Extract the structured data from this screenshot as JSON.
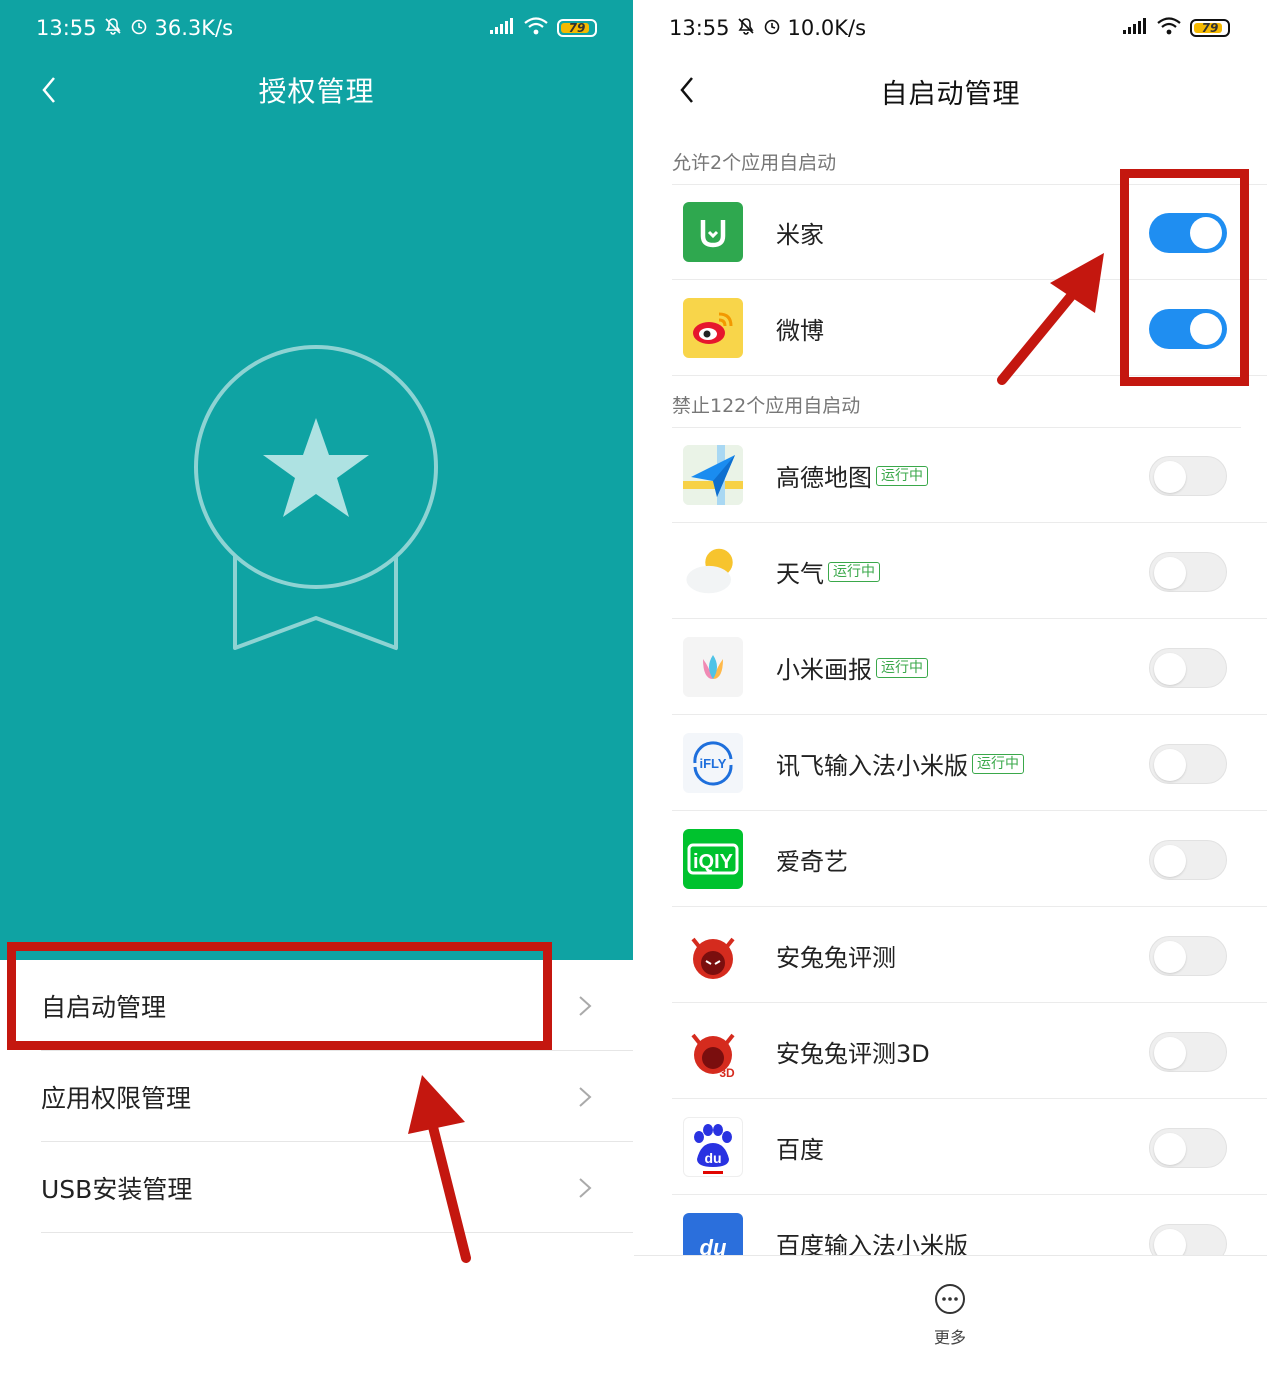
{
  "left": {
    "status": {
      "time": "13:55",
      "speed": "36.3K/s",
      "battery": "79"
    },
    "title": "授权管理",
    "menu": [
      {
        "label": "自启动管理"
      },
      {
        "label": "应用权限管理"
      },
      {
        "label": "USB安装管理"
      }
    ]
  },
  "right": {
    "status": {
      "time": "13:55",
      "speed": "10.0K/s",
      "battery": "79"
    },
    "title": "自启动管理",
    "allowed_header": "允许2个应用自启动",
    "blocked_header": "禁止122个应用自启动",
    "allowed_apps": [
      {
        "name": "米家",
        "enabled": true,
        "icon": "mijia-icon"
      },
      {
        "name": "微博",
        "enabled": true,
        "icon": "weibo-icon"
      }
    ],
    "blocked_apps": [
      {
        "name": "高德地图",
        "running": "运行中",
        "enabled": false,
        "icon": "amap-icon"
      },
      {
        "name": "天气",
        "running": "运行中",
        "enabled": false,
        "icon": "weather-icon"
      },
      {
        "name": "小米画报",
        "running": "运行中",
        "enabled": false,
        "icon": "mi-wallpaper-icon"
      },
      {
        "name": "讯飞输入法小米版",
        "running": "运行中",
        "enabled": false,
        "icon": "ifly-icon"
      },
      {
        "name": "爱奇艺",
        "enabled": false,
        "icon": "iqiyi-icon"
      },
      {
        "name": "安兔兔评测",
        "enabled": false,
        "icon": "antutu-icon"
      },
      {
        "name": "安兔兔评测3D",
        "enabled": false,
        "icon": "antutu-3d-icon"
      },
      {
        "name": "百度",
        "enabled": false,
        "icon": "baidu-icon"
      },
      {
        "name": "百度输入法小米版",
        "enabled": false,
        "icon": "baidu-input-icon"
      }
    ],
    "more_label": "更多",
    "ifly_text": "iFLY",
    "iqiyi_text": "iQIY",
    "baidu_text": "du",
    "antutu_3d_text": "3D"
  },
  "colors": {
    "teal": "#0fa3a3",
    "toggle_on": "#1f8ef1",
    "annotation_red": "#c4170f",
    "running_green": "#3aa84a"
  }
}
